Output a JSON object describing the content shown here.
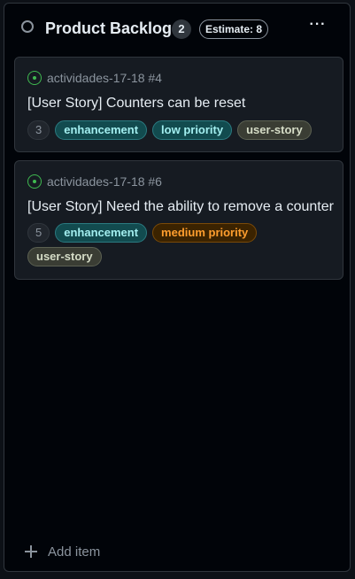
{
  "column": {
    "title": "Product Backlog",
    "count": "2",
    "estimate": "Estimate: 8",
    "more_label": "···",
    "status_icon": "circle-icon"
  },
  "cards": [
    {
      "repo_ref": "actividades-17-18 #4",
      "title": "[User Story] Counters can be reset",
      "estimate": "3",
      "labels": [
        "enhancement",
        "low priority",
        "user-story"
      ]
    },
    {
      "repo_ref": "actividades-17-18 #6",
      "title": "[User Story] Need the ability to remove a counter",
      "estimate": "5",
      "labels": [
        "enhancement",
        "medium priority",
        "user-story"
      ]
    }
  ],
  "footer": {
    "add_item_label": "Add item"
  },
  "colors": {
    "background": "#010409",
    "card": "#161b22",
    "open_issue": "#3fb950",
    "enhancement": "#a2eeef",
    "medium_priority": "#ff9e2e"
  }
}
